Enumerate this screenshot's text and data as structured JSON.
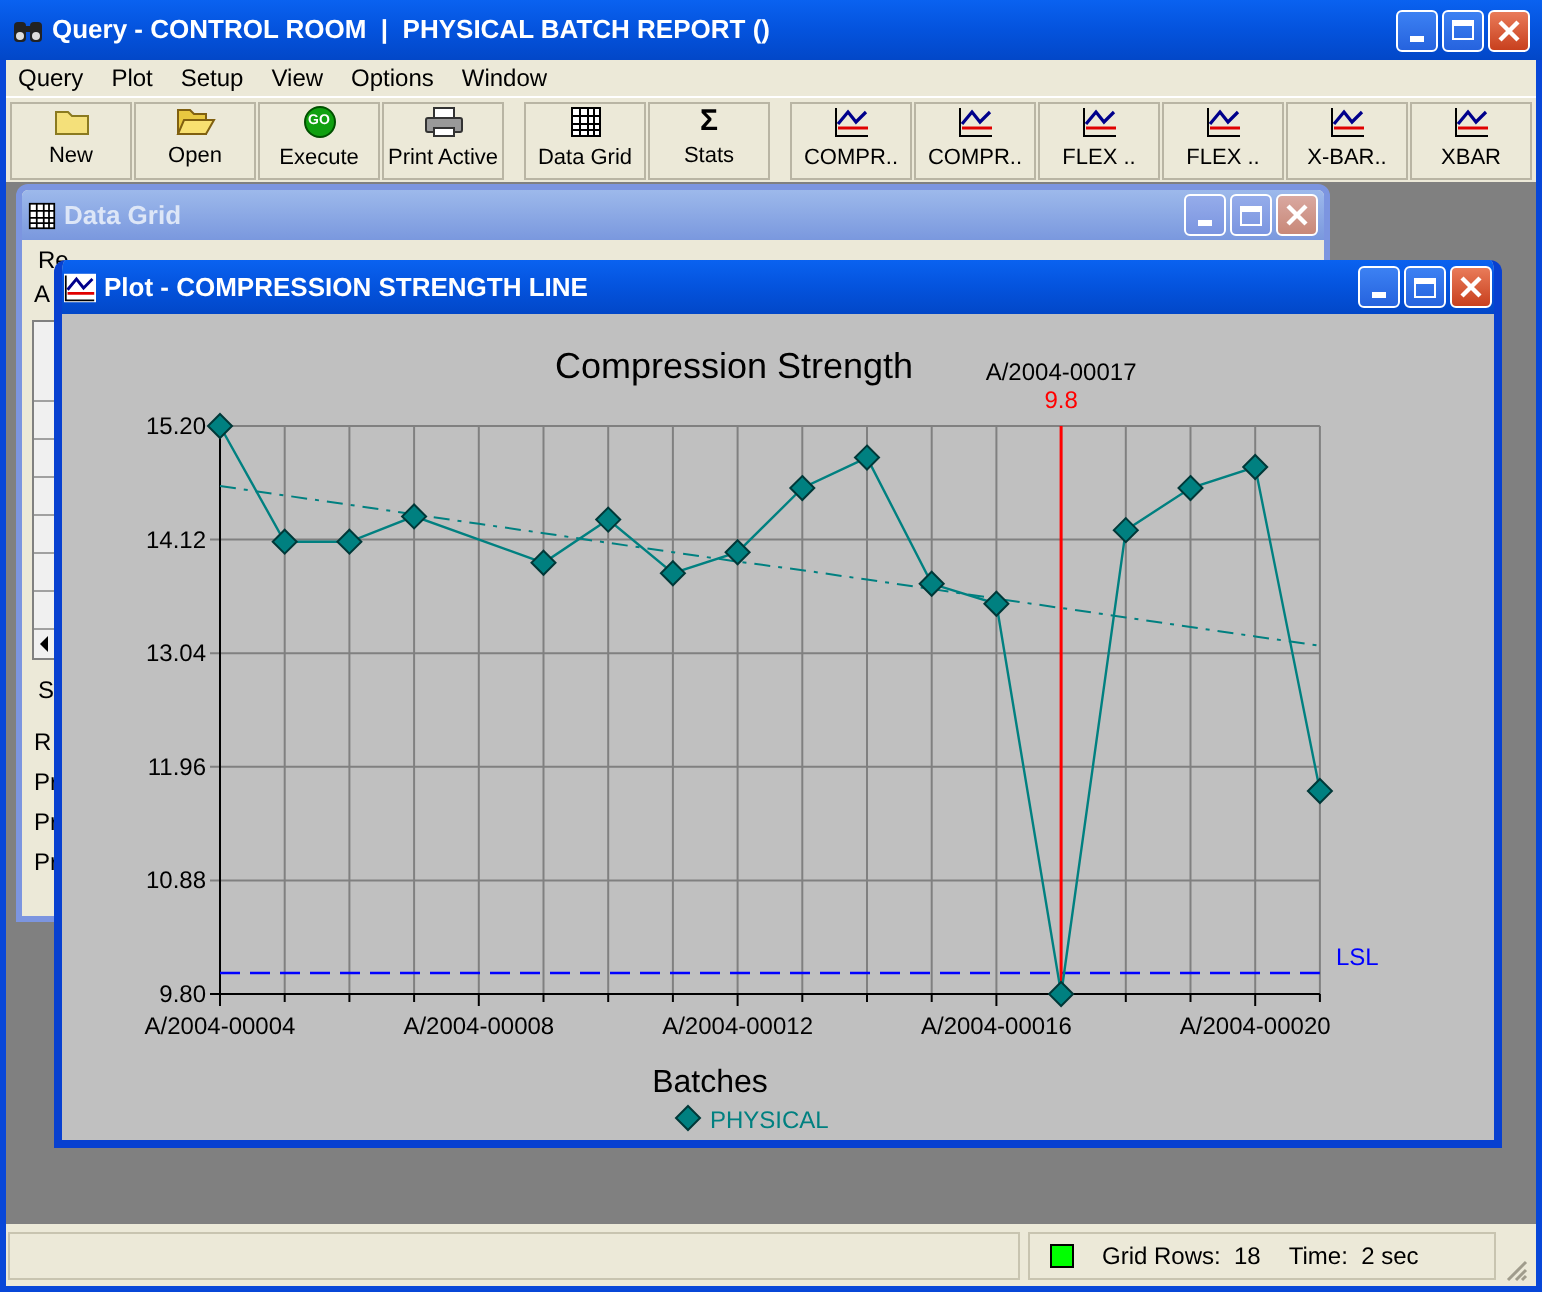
{
  "window": {
    "title": "Query - CONTROL ROOM  |  PHYSICAL BATCH REPORT ()"
  },
  "menu": [
    "Query",
    "Plot",
    "Setup",
    "View",
    "Options",
    "Window"
  ],
  "toolbar": [
    {
      "label": "New"
    },
    {
      "label": "Open"
    },
    {
      "label": "Execute",
      "glyph": "GO"
    },
    {
      "label": "Print Active"
    },
    {
      "label": "Data Grid"
    },
    {
      "label": "Stats",
      "glyph": "Σ"
    },
    {
      "label": "COMPR.."
    },
    {
      "label": "COMPR.."
    },
    {
      "label": "FLEX .."
    },
    {
      "label": "FLEX .."
    },
    {
      "label": "X-BAR.."
    },
    {
      "label": "XBAR"
    }
  ],
  "data_grid": {
    "title": "Data Grid",
    "active": false,
    "group_label": "Re",
    "line": "A",
    "section_label": "S",
    "fields": [
      "R",
      "Pr",
      "Pr",
      "Pr"
    ]
  },
  "plot_window": {
    "title": "Plot - COMPRESSION STRENGTH LINE",
    "active": true,
    "chart_data": {
      "type": "line",
      "title": "Compression Strength",
      "xlabel": "Batches",
      "categories": [
        "A/2004-00004",
        null,
        null,
        null,
        "A/2004-00008",
        null,
        null,
        null,
        "A/2004-00012",
        null,
        null,
        null,
        "A/2004-00016",
        null,
        null,
        null,
        "A/2004-00020",
        null
      ],
      "grid": true,
      "series": [
        {
          "name": "PHYSICAL",
          "color": "#008080",
          "marker": "diamond",
          "values": [
            15.2,
            14.1,
            14.1,
            14.34,
            null,
            13.9,
            14.31,
            13.8,
            14.0,
            14.61,
            14.9,
            13.7,
            13.51,
            9.8,
            14.21,
            14.61,
            14.81,
            11.73
          ]
        },
        {
          "color": "#008080",
          "line_style": "dashdot",
          "values": [
            14.63,
            14.54,
            14.45,
            14.36,
            14.27,
            14.18,
            14.09,
            14.0,
            13.91,
            13.83,
            13.74,
            13.65,
            13.56,
            13.47,
            13.38,
            13.29,
            13.2,
            13.11
          ]
        }
      ],
      "ylim": [
        9.8,
        15.2
      ],
      "yticks": [
        {
          "value": 15.2,
          "label": "15.20"
        },
        {
          "value": 14.12,
          "label": "14.12"
        },
        {
          "value": 13.04,
          "label": "13.04"
        },
        {
          "value": 11.96,
          "label": "11.96"
        },
        {
          "value": 10.88,
          "label": "10.88"
        },
        {
          "value": 9.8,
          "label": "9.80"
        }
      ],
      "ref_lines": [
        {
          "axis": "y",
          "value": 10.0,
          "label": "LSL"
        }
      ],
      "annotations": [
        {
          "text": "A/2004-00017"
        },
        {
          "text": "9.8"
        }
      ]
    }
  },
  "status_bar": {
    "grid_rows": "Grid Rows:  18",
    "time": "Time:  2 sec"
  }
}
